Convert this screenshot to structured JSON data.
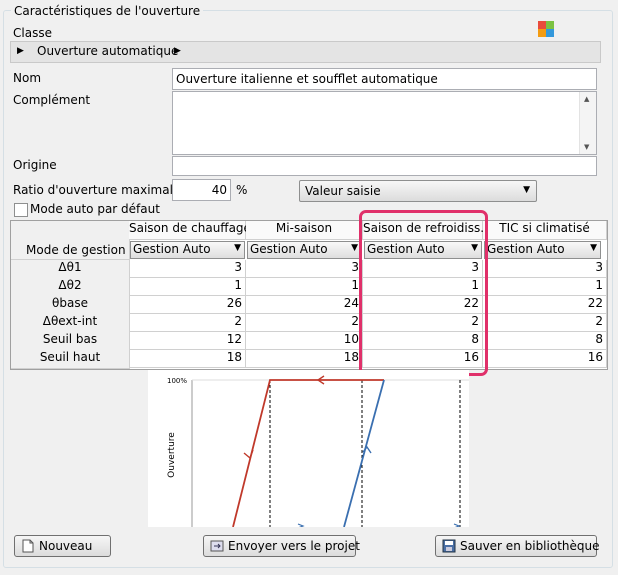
{
  "group_title": "Caractéristiques de l'ouverture",
  "classe": {
    "label": "Classe",
    "value": "Ouverture automatique"
  },
  "fields": {
    "nom_label": "Nom",
    "nom_value": "Ouverture italienne et soufflet automatique",
    "complement_label": "Complément",
    "complement_value": "",
    "origine_label": "Origine",
    "origine_value": ""
  },
  "ratio": {
    "label": "Ratio d'ouverture maximal",
    "value": "40",
    "unit": "%",
    "mode": "Valeur saisie"
  },
  "mode_auto": {
    "label": "Mode auto par défaut",
    "checked": false
  },
  "table": {
    "mode_label": "Mode de gestion",
    "columns": [
      {
        "title": "Saison de chauffage",
        "mode": "Gestion Auto"
      },
      {
        "title": "Mi-saison",
        "mode": "Gestion Auto"
      },
      {
        "title": "Saison de refroidiss.",
        "mode": "Gestion Auto"
      },
      {
        "title": "TIC si climatisé",
        "mode": "Gestion Auto"
      }
    ],
    "rows": [
      {
        "label": "Δθ1",
        "values": [
          "3",
          "3",
          "3",
          "3"
        ]
      },
      {
        "label": "Δθ2",
        "values": [
          "1",
          "1",
          "1",
          "1"
        ]
      },
      {
        "label": "θbase",
        "values": [
          "26",
          "24",
          "22",
          "22"
        ]
      },
      {
        "label": "Δθext-int",
        "values": [
          "2",
          "2",
          "2",
          "2"
        ]
      },
      {
        "label": "Seuil bas",
        "values": [
          "12",
          "10",
          "8",
          "8"
        ]
      },
      {
        "label": "Seuil haut",
        "values": [
          "18",
          "18",
          "16",
          "16"
        ]
      }
    ]
  },
  "chart": {
    "y_tick": "100%",
    "y_label": "Ouverture"
  },
  "buttons": {
    "nouveau": "Nouveau",
    "envoyer": "Envoyer vers le projet",
    "sauver": "Sauver en bibliothèque"
  },
  "colors": {
    "highlight": "#e0306a",
    "line_red": "#c0392b",
    "line_blue": "#3a6fb0"
  }
}
